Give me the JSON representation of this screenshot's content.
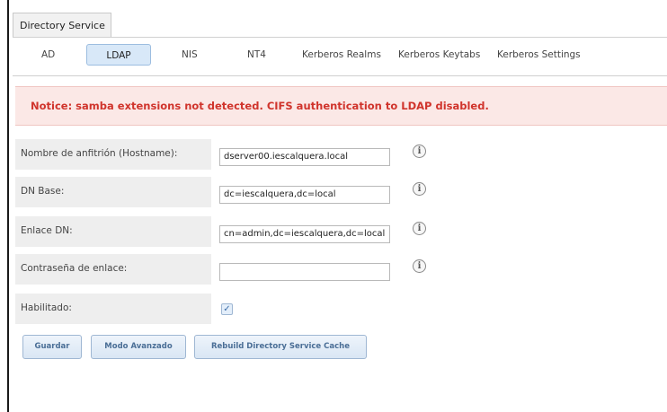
{
  "window": {
    "tab_title": "Directory Service"
  },
  "subtabs": [
    {
      "label": "AD"
    },
    {
      "label": "LDAP"
    },
    {
      "label": "NIS"
    },
    {
      "label": "NT4"
    },
    {
      "label": "Kerberos Realms"
    },
    {
      "label": "Kerberos Keytabs"
    },
    {
      "label": "Kerberos Settings"
    }
  ],
  "active_subtab": "LDAP",
  "notice": {
    "text": "Notice: samba extensions not detected. CIFS authentication to LDAP disabled."
  },
  "form": {
    "hostname": {
      "label": "Nombre de anfitrión (Hostname):",
      "value": "dserver00.iescalquera.local"
    },
    "base_dn": {
      "label": "DN Base:",
      "value": "dc=iescalquera,dc=local"
    },
    "bind_dn": {
      "label": "Enlace DN:",
      "value": "cn=admin,dc=iescalquera,dc=local"
    },
    "bind_password": {
      "label": "Contraseña de enlace:",
      "value": ""
    },
    "enabled": {
      "label": "Habilitado:",
      "checked": true
    }
  },
  "info_glyph": "i",
  "check_glyph": "✓",
  "buttons": {
    "save": "Guardar",
    "advanced": "Modo Avanzado",
    "rebuild": "Rebuild Directory Service Cache"
  },
  "colors": {
    "notice_text": "#d0342c",
    "notice_bg": "#fbe8e6",
    "active_tab_bg": "#d8e8f8",
    "button_text": "#4a6e96"
  }
}
